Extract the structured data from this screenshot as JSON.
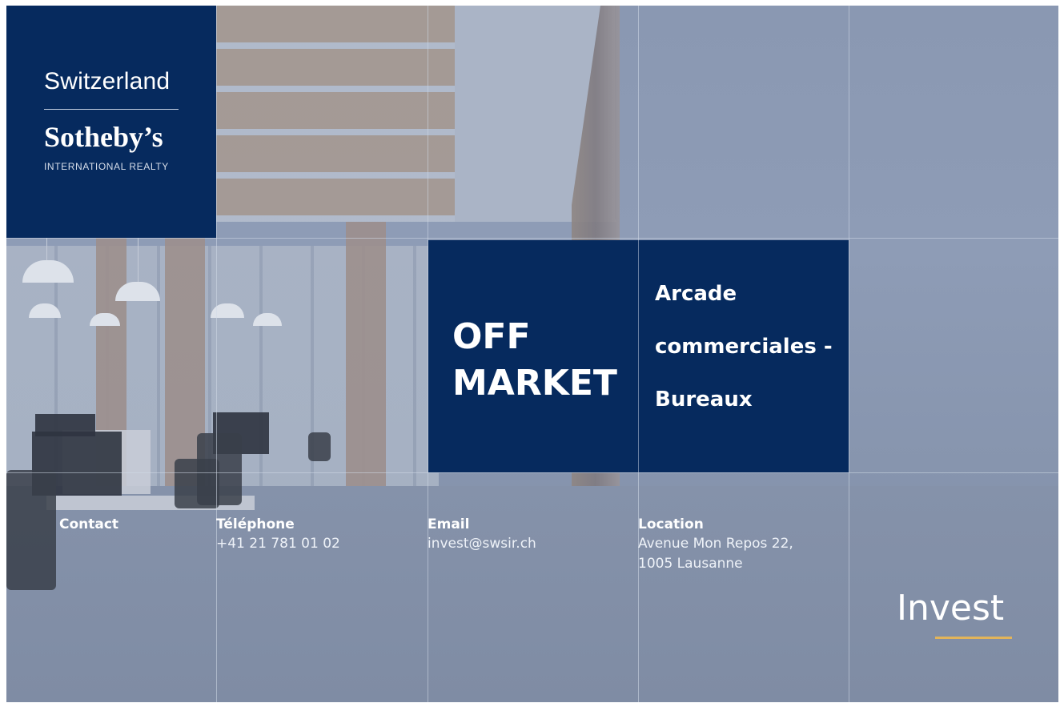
{
  "brand": {
    "name_top": "Switzerland",
    "name_main": "Sotheby’s",
    "name_sub": "INTERNATIONAL REALTY",
    "background_color": "#062a5e"
  },
  "offer": {
    "title_lines": [
      "OFF",
      "MARKET"
    ],
    "subtitle_lines": [
      "Arcade",
      "commerciales -",
      "Bureaux"
    ],
    "background_color": "#062a5e"
  },
  "contact": {
    "label": "Contact",
    "phone": {
      "label": "Téléphone",
      "value": "+41 21 781 01 02"
    },
    "email": {
      "label": "Email",
      "value": "invest@swsir.ch"
    },
    "location": {
      "label": "Location",
      "lines": [
        "Avenue Mon Repos 22,",
        "1005 Lausanne"
      ]
    }
  },
  "invest_logo": {
    "text": "Invest",
    "accent_color": "#e2b45a"
  }
}
